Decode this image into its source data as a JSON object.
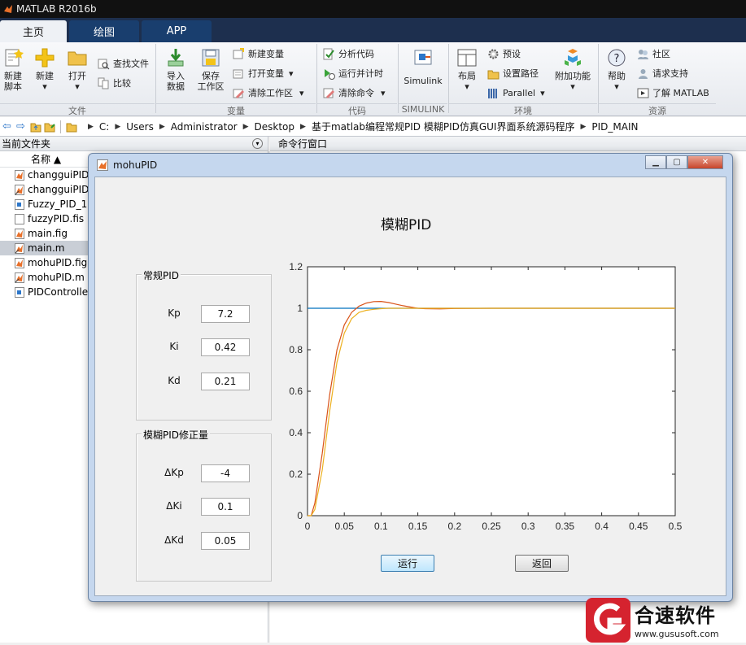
{
  "app": {
    "title": "MATLAB R2016b"
  },
  "tabs": [
    {
      "label": "主页"
    },
    {
      "label": "绘图"
    },
    {
      "label": "APP"
    }
  ],
  "ribbon": {
    "file": {
      "new_script": [
        "新建",
        "脚本"
      ],
      "new": "新建",
      "open": "打开",
      "find_files": "查找文件",
      "compare": "比较",
      "group": "文件"
    },
    "variable": {
      "import": [
        "导入",
        "数据"
      ],
      "save": [
        "保存",
        "工作区"
      ],
      "new_var": "新建变量",
      "open_var": "打开变量",
      "clear_ws": "清除工作区",
      "group": "变量"
    },
    "code": {
      "analyze": "分析代码",
      "run_time": "运行并计时",
      "clear_cmd": "清除命令",
      "group": "代码"
    },
    "simulink": {
      "btn": "Simulink",
      "group": "SIMULINK"
    },
    "env": {
      "layout": "布局",
      "prefs": "预设",
      "set_path": "设置路径",
      "parallel": "Parallel",
      "addons": "附加功能",
      "group": "环境"
    },
    "res": {
      "help": "帮助",
      "community": "社区",
      "support": "请求支持",
      "learn": "了解 MATLAB",
      "group": "资源"
    }
  },
  "address": {
    "crumbs": [
      "C:",
      "Users",
      "Administrator",
      "Desktop",
      "基于matlab编程常规PID 模糊PID仿真GUI界面系统源码程序",
      "PID_MAIN"
    ]
  },
  "current_folder": {
    "title": "当前文件夹",
    "col_name": "名称 ▲",
    "files": [
      {
        "name": "changguiPID",
        "icon": "fig-file-icon"
      },
      {
        "name": "changguiPID",
        "icon": "m-file-icon"
      },
      {
        "name": "Fuzzy_PID_1.r",
        "icon": "mdl-file-icon"
      },
      {
        "name": "fuzzyPID.fis",
        "icon": "file-icon"
      },
      {
        "name": "main.fig",
        "icon": "fig-file-icon"
      },
      {
        "name": "main.m",
        "icon": "m-file-icon",
        "selected": true
      },
      {
        "name": "mohuPID.fig",
        "icon": "fig-file-icon"
      },
      {
        "name": "mohuPID.m",
        "icon": "m-file-icon"
      },
      {
        "name": "PIDControlle",
        "icon": "mdl-file-icon"
      }
    ]
  },
  "command_window": {
    "title": "命令行窗口"
  },
  "figure_window": {
    "title": "mohuPID",
    "heading": "模糊PID",
    "pid_panel": {
      "title": "常规PID",
      "fields": [
        {
          "label": "Kp",
          "value": "7.2"
        },
        {
          "label": "Ki",
          "value": "0.42"
        },
        {
          "label": "Kd",
          "value": "0.21"
        }
      ]
    },
    "fuzzy_panel": {
      "title": "模糊PID修正量",
      "fields": [
        {
          "label": "ΔKp",
          "value": "-4"
        },
        {
          "label": "ΔKi",
          "value": "0.1"
        },
        {
          "label": "ΔKd",
          "value": "0.05"
        }
      ]
    },
    "run_button": "运行",
    "back_button": "返回"
  },
  "chart_data": {
    "type": "line",
    "xlim": [
      0,
      0.5
    ],
    "ylim": [
      0,
      1.2
    ],
    "xticks": [
      "0",
      "0.05",
      "0.1",
      "0.15",
      "0.2",
      "0.25",
      "0.3",
      "0.35",
      "0.4",
      "0.45",
      "0.5"
    ],
    "yticks": [
      "0",
      "0.2",
      "0.4",
      "0.6",
      "0.8",
      "1",
      "1.2"
    ],
    "grid": false,
    "series": [
      {
        "color": "#0072bd",
        "x": [
          0,
          0.5
        ],
        "y": [
          1,
          1
        ]
      },
      {
        "color": "#d95319",
        "x": [
          0,
          0.005,
          0.01,
          0.02,
          0.03,
          0.04,
          0.05,
          0.06,
          0.07,
          0.08,
          0.09,
          0.1,
          0.11,
          0.12,
          0.13,
          0.14,
          0.15,
          0.16,
          0.18,
          0.2,
          0.25,
          0.3,
          0.4,
          0.5
        ],
        "y": [
          0,
          0.0,
          0.06,
          0.3,
          0.58,
          0.8,
          0.92,
          0.98,
          1.01,
          1.025,
          1.032,
          1.033,
          1.028,
          1.02,
          1.012,
          1.006,
          1.0,
          0.998,
          0.997,
          0.999,
          1.0,
          1.0,
          1.0,
          1.0
        ]
      },
      {
        "color": "#edb120",
        "x": [
          0,
          0.005,
          0.01,
          0.02,
          0.03,
          0.04,
          0.05,
          0.06,
          0.07,
          0.08,
          0.09,
          0.1,
          0.11,
          0.12,
          0.14,
          0.16,
          0.2,
          0.25,
          0.3,
          0.4,
          0.5
        ],
        "y": [
          0,
          0.0,
          0.03,
          0.22,
          0.5,
          0.74,
          0.88,
          0.95,
          0.98,
          0.99,
          0.995,
          0.998,
          1.0,
          1.0,
          1.0,
          1.0,
          1.0,
          1.0,
          1.0,
          1.0,
          1.0
        ]
      }
    ]
  },
  "watermark": {
    "brand": "合速软件",
    "url": "www.gususoft.com",
    "color": "#d5232f"
  }
}
